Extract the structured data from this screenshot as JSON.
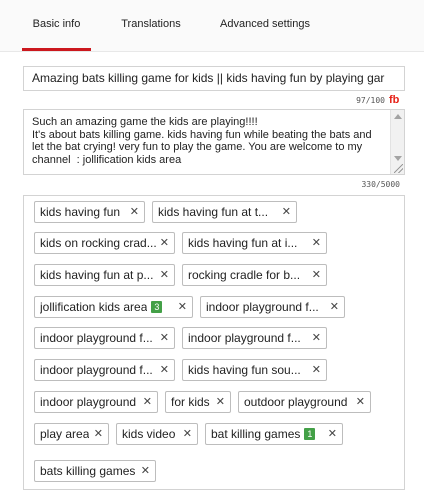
{
  "tabs": [
    {
      "label": "Basic info",
      "active": true
    },
    {
      "label": "Translations",
      "active": false
    },
    {
      "label": "Advanced settings",
      "active": false
    }
  ],
  "accent_color": "#cc181e",
  "title": {
    "value": "Amazing bats killing game for kids || kids having fun by playing gar",
    "counter": "97/100",
    "icon": "fb-icon"
  },
  "description": {
    "value": "Such an amazing game the kids are playing!!!!\nIt's about bats killing game. kids having fun while beating the bats and let the bat crying! very fun to play the game. You are welcome to my channel  : jollification kids area",
    "counter": "330/5000"
  },
  "tags": [
    {
      "label": "kids having fun"
    },
    {
      "label": "kids having fun at t..."
    },
    {
      "label": "kids on rocking crad..."
    },
    {
      "label": "kids having fun at i..."
    },
    {
      "label": "kids having fun at p..."
    },
    {
      "label": "rocking cradle for b..."
    },
    {
      "label": "jollification kids area",
      "count": "3"
    },
    {
      "label": "indoor playground f..."
    },
    {
      "label": "indoor playground f..."
    },
    {
      "label": "indoor playground f..."
    },
    {
      "label": "indoor playground f..."
    },
    {
      "label": "kids having fun sou..."
    },
    {
      "label": "indoor playground"
    },
    {
      "label": "for kids"
    },
    {
      "label": "outdoor playground"
    },
    {
      "label": "play area"
    },
    {
      "label": "kids video"
    },
    {
      "label": "bat killing games",
      "count": "1"
    },
    {
      "label": "bats killing games"
    }
  ],
  "tag_count_color": "#43a047"
}
